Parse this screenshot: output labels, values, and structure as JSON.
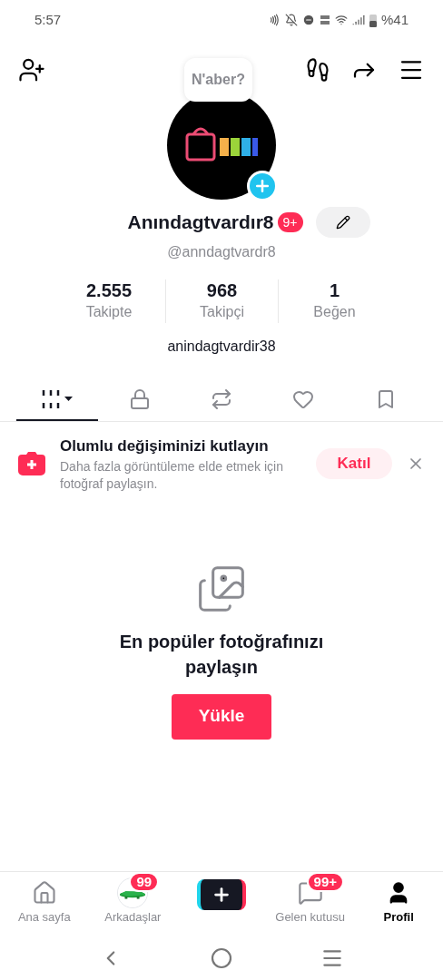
{
  "status_bar": {
    "time": "5:57",
    "battery": "%41"
  },
  "profile": {
    "bubble": "N'aber?",
    "name": "Anındagtvardır8",
    "badge": "9+",
    "handle": "@anndagtvardr8",
    "bio": "anindagtvardir38"
  },
  "stats": [
    {
      "value": "2.555",
      "label": "Takipte"
    },
    {
      "value": "968",
      "label": "Takipçi"
    },
    {
      "value": "1",
      "label": "Beğen"
    }
  ],
  "tabs": [
    {
      "kind": "grid",
      "selected": true
    },
    {
      "kind": "lock",
      "selected": false
    },
    {
      "kind": "repost",
      "selected": false
    },
    {
      "kind": "heart",
      "selected": false
    },
    {
      "kind": "bookmark",
      "selected": false
    }
  ],
  "banner": {
    "title": "Olumlu değişiminizi kutlayın",
    "text": "Daha fazla görüntüleme elde etmek için fotoğraf paylaşın.",
    "button": "Katıl"
  },
  "empty": {
    "title": "En popüler fotoğrafınızı paylaşın",
    "button": "Yükle"
  },
  "nav": [
    {
      "kind": "home",
      "label": "Ana sayfa",
      "selected": false
    },
    {
      "kind": "friends",
      "label": "Arkadaşlar",
      "badge": "99",
      "selected": false
    },
    {
      "kind": "create",
      "selected": false
    },
    {
      "kind": "inbox",
      "label": "Gelen kutusu",
      "badge": "99+",
      "selected": false
    },
    {
      "kind": "profile",
      "label": "Profil",
      "selected": true
    }
  ]
}
